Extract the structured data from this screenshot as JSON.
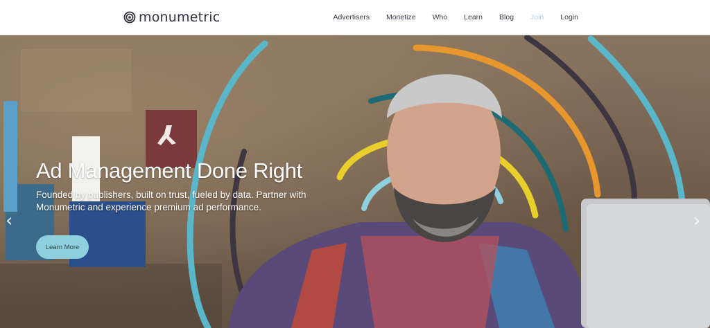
{
  "brand": {
    "name": "monumetric",
    "logo_icon": "spiral-logo-icon"
  },
  "nav": {
    "items": [
      {
        "label": "Advertisers"
      },
      {
        "label": "Monetize"
      },
      {
        "label": "Who"
      },
      {
        "label": "Learn"
      },
      {
        "label": "Blog"
      },
      {
        "label": "Join"
      },
      {
        "label": "Login"
      }
    ]
  },
  "hero": {
    "title": "Ad Management Done Right",
    "subtitle": "Founded by publishers, built on trust, fueled by data. Partner with Monumetric and experience premium ad performance.",
    "cta_label": "Learn More",
    "prev_icon": "chevron-left-icon",
    "next_icon": "chevron-right-icon",
    "prev_glyph": "‹",
    "next_glyph": "›"
  },
  "colors": {
    "accent": "#8fd0de",
    "ring_teal": "#5ab7c9",
    "ring_orange": "#e8962e",
    "ring_yellow": "#e9cf2b",
    "ring_dark": "#3d3540",
    "ring_deepteal": "#1c6b74"
  }
}
